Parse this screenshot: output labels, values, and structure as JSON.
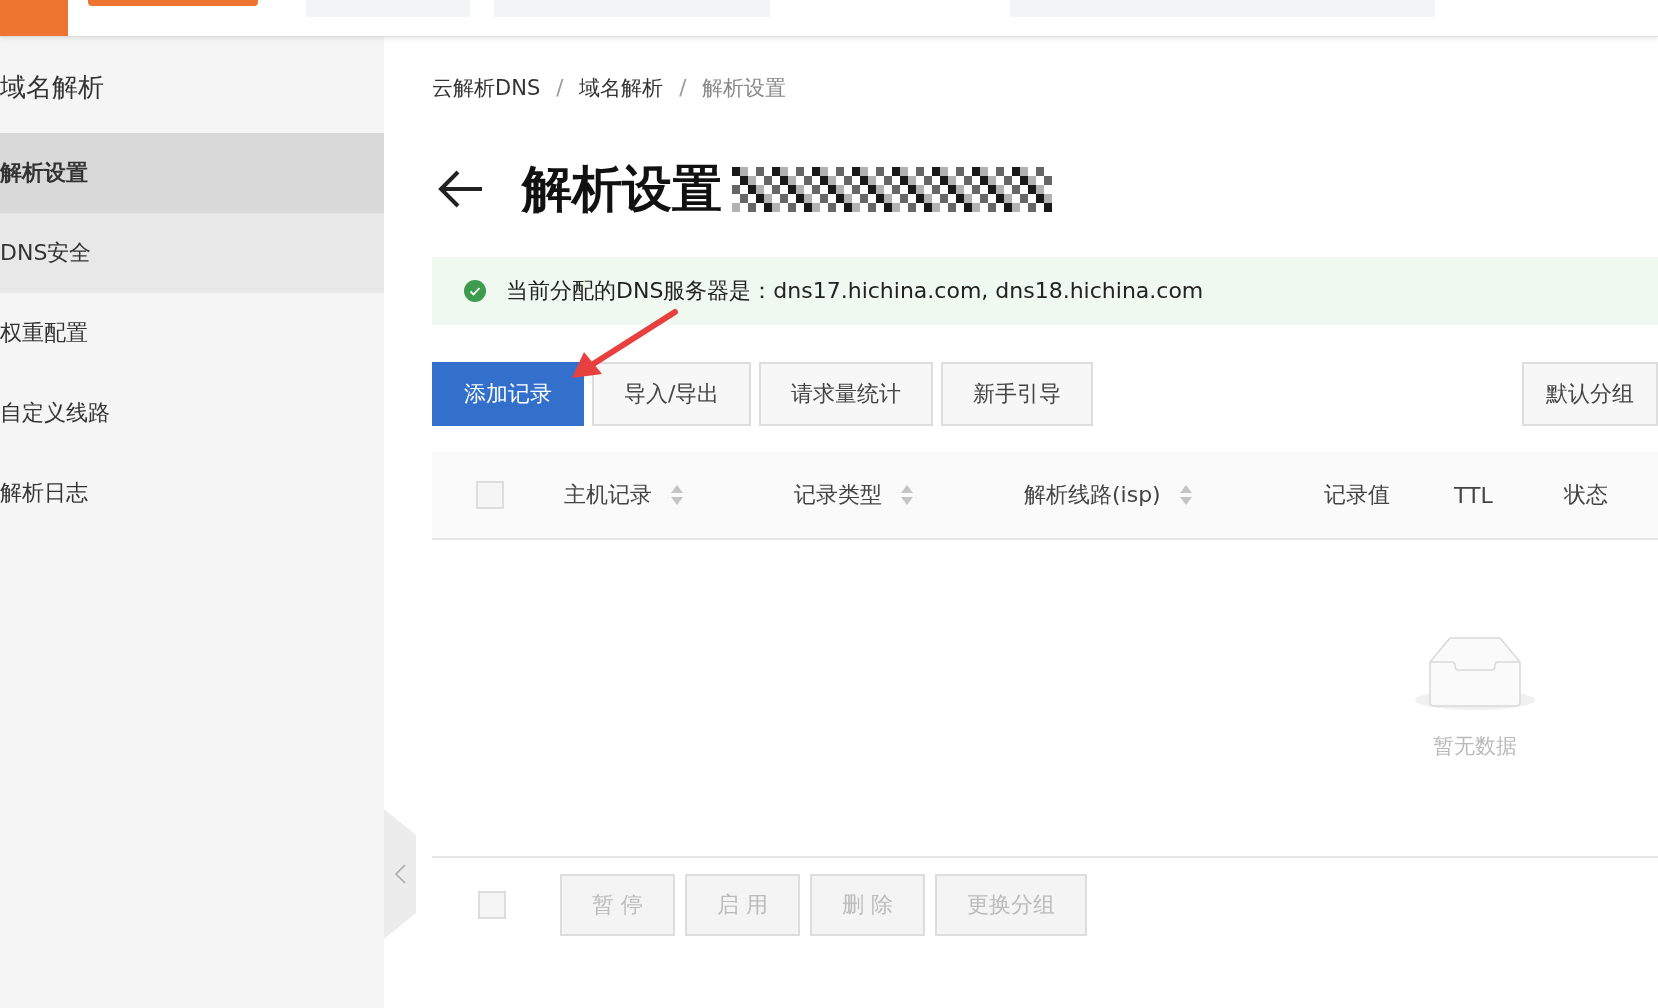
{
  "sidebar": {
    "title": "域名解析",
    "items": [
      {
        "label": "解析设置",
        "selected": true,
        "hovered": false
      },
      {
        "label": "DNS安全",
        "selected": false,
        "hovered": true
      },
      {
        "label": "权重配置",
        "selected": false,
        "hovered": false
      },
      {
        "label": "自定义线路",
        "selected": false,
        "hovered": false
      },
      {
        "label": "解析日志",
        "selected": false,
        "hovered": false
      }
    ]
  },
  "breadcrumb": [
    {
      "label": "云解析DNS",
      "current": false
    },
    {
      "label": "域名解析",
      "current": false
    },
    {
      "label": "解析设置",
      "current": true
    }
  ],
  "breadcrumb_separator": "/",
  "page_title": "解析设置",
  "notice": "当前分配的DNS服务器是：dns17.hichina.com, dns18.hichina.com",
  "toolbar": [
    {
      "label": "添加记录",
      "kind": "primary"
    },
    {
      "label": "导入/导出",
      "kind": "default"
    },
    {
      "label": "请求量统计",
      "kind": "default"
    },
    {
      "label": "新手引导",
      "kind": "default"
    }
  ],
  "group_button": "默认分组",
  "table": {
    "checked": false,
    "columns": [
      {
        "label": "主机记录",
        "sortable": true
      },
      {
        "label": "记录类型",
        "sortable": true
      },
      {
        "label": "解析线路(isp)",
        "sortable": true
      },
      {
        "label": "记录值",
        "sortable": false
      },
      {
        "label": "TTL",
        "sortable": false
      },
      {
        "label": "状态",
        "sortable": false
      }
    ],
    "empty_text": "暂无数据"
  },
  "footer": {
    "checked": false,
    "buttons": [
      {
        "label": "暂 停",
        "disabled": true
      },
      {
        "label": "启 用",
        "disabled": true
      },
      {
        "label": "删 除",
        "disabled": true
      },
      {
        "label": "更换分组",
        "disabled": true
      }
    ]
  }
}
